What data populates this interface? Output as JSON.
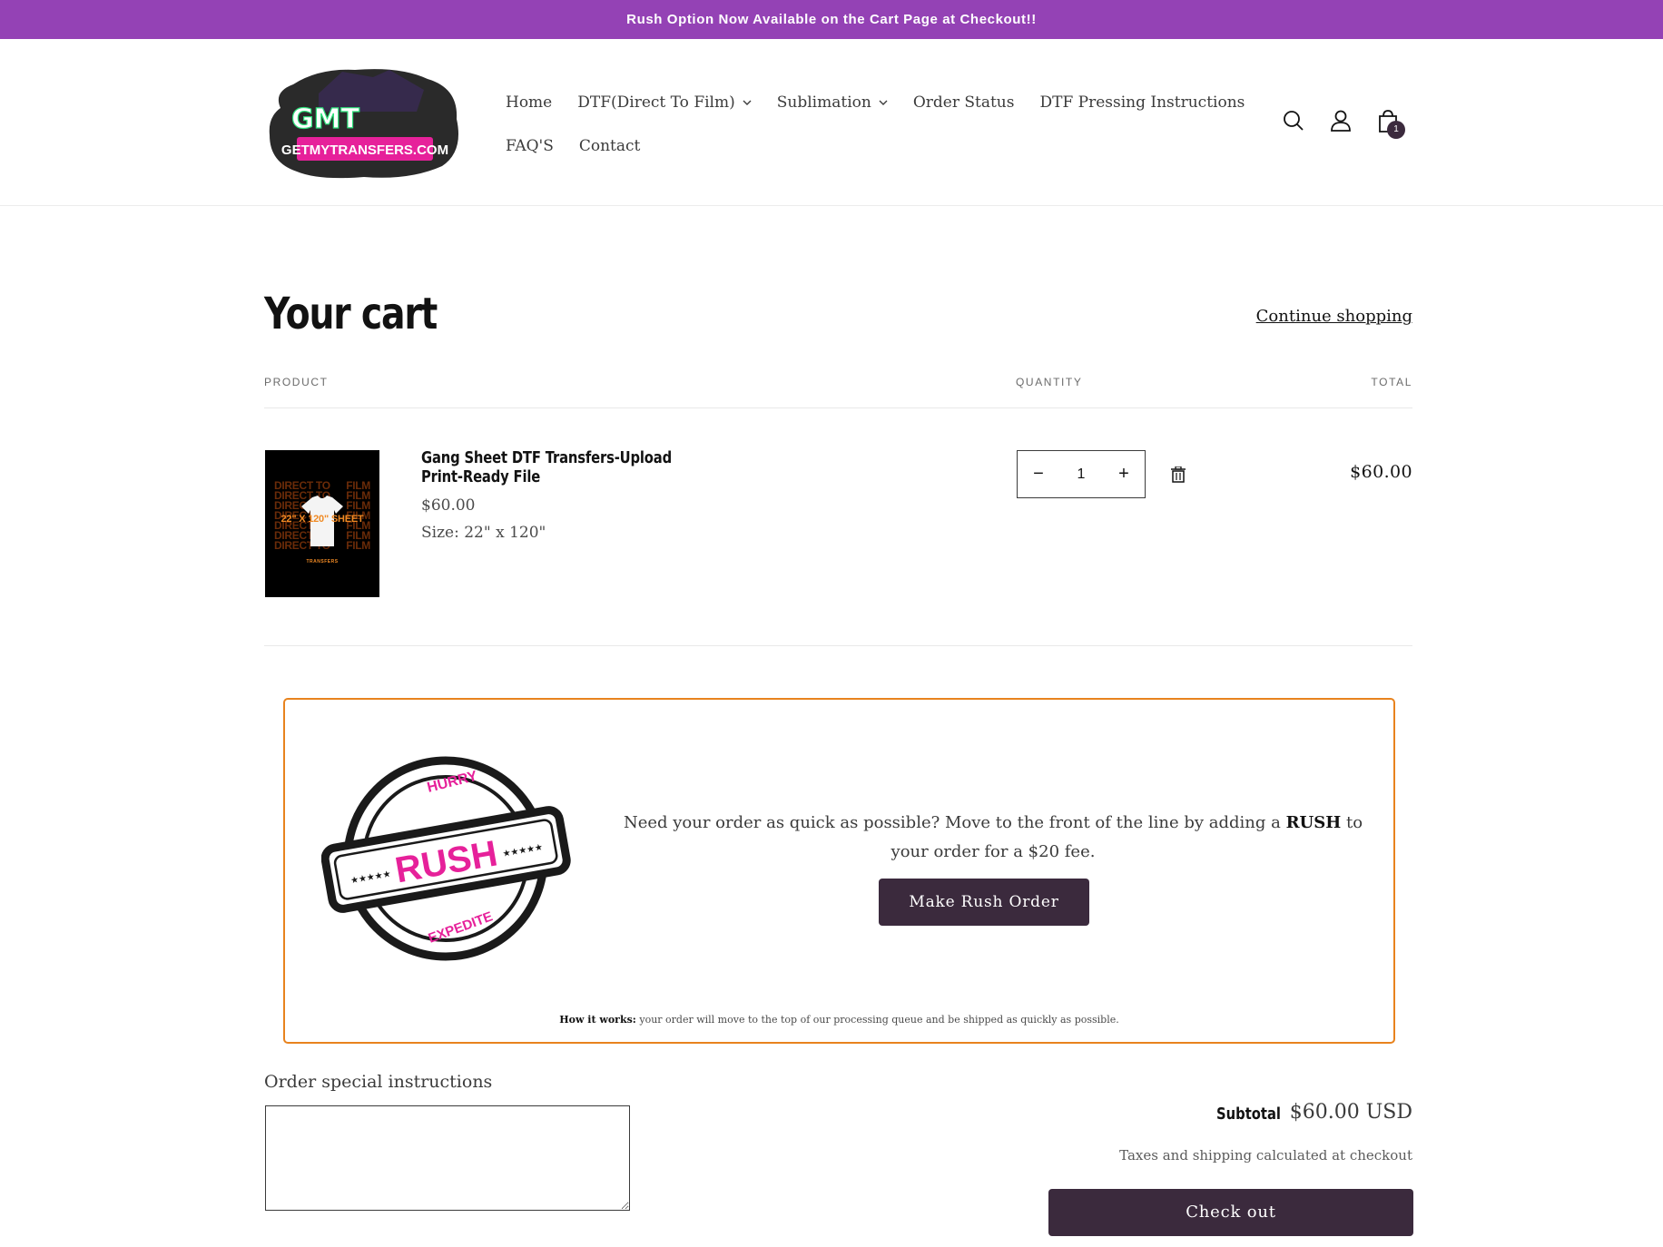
{
  "announcement": "Rush Option Now Available on the Cart Page at Checkout!!",
  "logo": {
    "letters": "GMT",
    "wordmark": "GETMYTRANSFERS.COM"
  },
  "nav": {
    "row1": [
      {
        "label": "Home",
        "dropdown": false
      },
      {
        "label": "DTF(Direct To Film)",
        "dropdown": true
      },
      {
        "label": "Sublimation",
        "dropdown": true
      },
      {
        "label": "Order Status",
        "dropdown": false
      },
      {
        "label": "DTF Pressing Instructions",
        "dropdown": false
      }
    ],
    "row2": [
      {
        "label": "FAQ'S",
        "dropdown": false
      },
      {
        "label": "Contact",
        "dropdown": false
      }
    ]
  },
  "header_icons": {
    "search": "search-icon",
    "account": "user-icon",
    "cart": "cart-icon",
    "cart_count": "1"
  },
  "cart": {
    "title": "Your cart",
    "continue_label": "Continue shopping",
    "columns": {
      "product": "PRODUCT",
      "quantity": "QUANTITY",
      "total": "TOTAL"
    },
    "items": [
      {
        "name": "Gang Sheet DTF Transfers-Upload Print-Ready File",
        "price": "$60.00",
        "size": "Size: 22\" x 120\"",
        "quantity": "1",
        "line_total": "$60.00",
        "thumbnail": {
          "repeat_lines": [
            "DIRECT TO FILM",
            "DIRECT TO FILM",
            "DIRECT TO FILM",
            "DIRECT TO FILM",
            "DIRECT TO FILM",
            "DIRECT TO FILM",
            "DIRECT TO FILM"
          ],
          "headline": "22\" X 120\" SHEET",
          "brand": "TRANSFERS"
        }
      }
    ]
  },
  "rush": {
    "stamp": {
      "top": "HURRY",
      "main": "RUSH",
      "bottom": "EXPEDITE",
      "stars": "★★★★★"
    },
    "text_before": "Need your order as quick as possible? Move to the front of the line by adding a ",
    "text_bold": "RUSH",
    "text_after": " to your order for a $20 fee.",
    "button": "Make Rush Order",
    "how_label": "How it works:",
    "how_text": " your order will move to the top of our processing queue and be shipped as quickly as possible."
  },
  "instructions": {
    "label": "Order special instructions",
    "value": ""
  },
  "summary": {
    "subtotal_label": "Subtotal",
    "subtotal_value": "$60.00 USD",
    "taxes_note": "Taxes and shipping calculated at checkout",
    "checkout_label": "Check out"
  },
  "colors": {
    "announce_bg": "#9442b5",
    "button_bg": "#3b2a3d",
    "rush_border": "#e8831e",
    "rush_pink": "#e6219a"
  }
}
